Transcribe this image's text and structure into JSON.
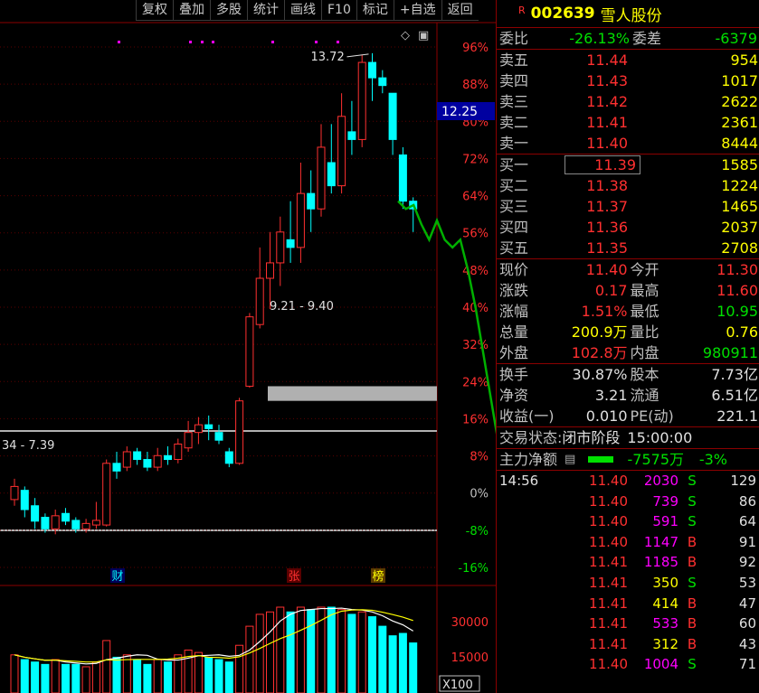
{
  "toolbar": {
    "items": [
      "复权",
      "叠加",
      "多股",
      "统计",
      "画线",
      "F10",
      "标记",
      "+自选",
      "返回"
    ]
  },
  "chart": {
    "pct_labels": [
      "96%",
      "88%",
      "80%",
      "72%",
      "64%",
      "56%",
      "48%",
      "40%",
      "32%",
      "24%",
      "16%",
      "8%",
      "0%",
      "-8%",
      "-16%"
    ],
    "price_tag": "12.25",
    "high_annotation": "13.72",
    "gap_label_1": "9.21 - 9.40",
    "gap_label_2": "34 - 7.39",
    "markers": {
      "cai": "财",
      "zhang": "张",
      "bang": "榜"
    },
    "vol_labels": [
      "30000",
      "15000"
    ],
    "vol_unit": "X100",
    "colors": {
      "up": "#ff3030",
      "down": "#00ffff",
      "ma1": "#ffffff",
      "ma2": "#ffff00",
      "forecast": "#00b000"
    }
  },
  "chart_data": {
    "type": "candlestick",
    "candles": [
      {
        "o": 7.93,
        "c": 8.1,
        "h": 8.2,
        "l": 7.85
      },
      {
        "o": 8.05,
        "c": 7.8,
        "h": 8.1,
        "l": 7.7
      },
      {
        "o": 7.85,
        "c": 7.65,
        "h": 7.95,
        "l": 7.55
      },
      {
        "o": 7.7,
        "c": 7.55,
        "h": 7.75,
        "l": 7.5
      },
      {
        "o": 7.55,
        "c": 7.72,
        "h": 7.8,
        "l": 7.48
      },
      {
        "o": 7.75,
        "c": 7.65,
        "h": 7.82,
        "l": 7.6
      },
      {
        "o": 7.66,
        "c": 7.55,
        "h": 7.7,
        "l": 7.5
      },
      {
        "o": 7.55,
        "c": 7.62,
        "h": 7.68,
        "l": 7.5
      },
      {
        "o": 7.6,
        "c": 7.66,
        "h": 7.9,
        "l": 7.55
      },
      {
        "o": 7.6,
        "c": 8.4,
        "h": 8.45,
        "l": 7.58
      },
      {
        "o": 8.4,
        "c": 8.3,
        "h": 8.55,
        "l": 8.2
      },
      {
        "o": 8.35,
        "c": 8.55,
        "h": 8.62,
        "l": 8.3
      },
      {
        "o": 8.55,
        "c": 8.45,
        "h": 8.6,
        "l": 8.38
      },
      {
        "o": 8.45,
        "c": 8.35,
        "h": 8.55,
        "l": 8.3
      },
      {
        "o": 8.35,
        "c": 8.5,
        "h": 8.6,
        "l": 8.3
      },
      {
        "o": 8.5,
        "c": 8.45,
        "h": 8.62,
        "l": 8.38
      },
      {
        "o": 8.45,
        "c": 8.65,
        "h": 8.72,
        "l": 8.4
      },
      {
        "o": 8.6,
        "c": 8.8,
        "h": 8.95,
        "l": 8.55
      },
      {
        "o": 8.8,
        "c": 8.9,
        "h": 9.0,
        "l": 8.65
      },
      {
        "o": 8.9,
        "c": 8.85,
        "h": 9.02,
        "l": 8.7
      },
      {
        "o": 8.8,
        "c": 8.7,
        "h": 8.9,
        "l": 8.65
      },
      {
        "o": 8.55,
        "c": 8.4,
        "h": 8.6,
        "l": 8.35
      },
      {
        "o": 8.4,
        "c": 9.21,
        "h": 9.25,
        "l": 8.38
      },
      {
        "o": 9.4,
        "c": 10.3,
        "h": 10.35,
        "l": 9.38
      },
      {
        "o": 10.2,
        "c": 10.8,
        "h": 11.2,
        "l": 10.15
      },
      {
        "o": 10.8,
        "c": 11.0,
        "h": 11.4,
        "l": 10.4
      },
      {
        "o": 11.0,
        "c": 11.4,
        "h": 11.6,
        "l": 10.7
      },
      {
        "o": 11.3,
        "c": 11.2,
        "h": 11.8,
        "l": 11.0
      },
      {
        "o": 11.2,
        "c": 11.9,
        "h": 12.3,
        "l": 11.0
      },
      {
        "o": 11.9,
        "c": 11.7,
        "h": 12.2,
        "l": 11.4
      },
      {
        "o": 11.7,
        "c": 12.5,
        "h": 12.8,
        "l": 11.6
      },
      {
        "o": 12.3,
        "c": 12.0,
        "h": 12.8,
        "l": 11.9
      },
      {
        "o": 12.0,
        "c": 12.9,
        "h": 13.2,
        "l": 11.9
      },
      {
        "o": 12.7,
        "c": 12.6,
        "h": 13.1,
        "l": 12.4
      },
      {
        "o": 12.6,
        "c": 13.6,
        "h": 13.7,
        "l": 12.5
      },
      {
        "o": 13.6,
        "c": 13.4,
        "h": 13.72,
        "l": 13.1
      },
      {
        "o": 13.4,
        "c": 13.3,
        "h": 13.5,
        "l": 13.2
      },
      {
        "o": 13.2,
        "c": 12.6,
        "h": 13.2,
        "l": 12.4
      },
      {
        "o": 12.4,
        "c": 11.8,
        "h": 12.5,
        "l": 11.7
      },
      {
        "o": 11.8,
        "c": 11.7,
        "h": 11.85,
        "l": 11.4
      }
    ],
    "volumes": [
      16,
      14,
      13,
      12,
      14,
      12,
      12,
      11,
      13,
      22,
      15,
      16,
      14,
      12,
      14,
      13,
      16,
      18,
      17,
      15,
      14,
      13,
      20,
      28,
      33,
      34,
      36,
      34,
      36,
      35,
      36,
      36,
      35,
      33,
      34,
      32,
      28,
      24,
      25,
      21
    ],
    "forecast": [
      11.8,
      11.7,
      11.75,
      11.5,
      11.3,
      11.55,
      11.3,
      11.2,
      11.3,
      10.9,
      10.4,
      9.8,
      9.2,
      8.6,
      8.0,
      7.6
    ],
    "price_ylim": [
      7.05,
      13.8
    ],
    "pct_ylim": [
      -16,
      96
    ]
  },
  "panel": {
    "flag": "R",
    "code": "002639",
    "name": "雪人股份",
    "weibi": {
      "l1": "委比",
      "v1": "-26.13%",
      "l2": "委差",
      "v2": "-6379"
    },
    "asks": [
      {
        "label": "卖五",
        "price": "11.44",
        "vol": "954"
      },
      {
        "label": "卖四",
        "price": "11.43",
        "vol": "1017"
      },
      {
        "label": "卖三",
        "price": "11.42",
        "vol": "2622"
      },
      {
        "label": "卖二",
        "price": "11.41",
        "vol": "2361"
      },
      {
        "label": "卖一",
        "price": "11.40",
        "vol": "8444"
      }
    ],
    "bids": [
      {
        "label": "买一",
        "price": "11.39",
        "vol": "1585"
      },
      {
        "label": "买二",
        "price": "11.38",
        "vol": "1224"
      },
      {
        "label": "买三",
        "price": "11.37",
        "vol": "1465"
      },
      {
        "label": "买四",
        "price": "11.36",
        "vol": "2037"
      },
      {
        "label": "买五",
        "price": "11.35",
        "vol": "2708"
      }
    ],
    "stats": [
      {
        "l1": "现价",
        "v1": "11.40",
        "l2": "今开",
        "v2": "11.30"
      },
      {
        "l1": "涨跌",
        "v1": "0.17",
        "l2": "最高",
        "v2": "11.60"
      },
      {
        "l1": "涨幅",
        "v1": "1.51%",
        "l2": "最低",
        "v2": "10.95"
      },
      {
        "l1": "总量",
        "v1": "200.9万",
        "l2": "量比",
        "v2": "0.76"
      },
      {
        "l1": "外盘",
        "v1": "102.8万",
        "l2": "内盘",
        "v2": "980911"
      }
    ],
    "stats2": [
      {
        "l1": "换手",
        "v1": "30.87%",
        "l2": "股本",
        "v2": "7.73亿"
      },
      {
        "l1": "净资",
        "v1": "3.21",
        "l2": "流通",
        "v2": "6.51亿"
      },
      {
        "l1": "收益(一)",
        "v1": "0.010",
        "l2": "PE(动)",
        "v2": "221.1"
      }
    ],
    "trade_status": {
      "label": "交易状态:",
      "value": "闭市阶段",
      "time": "15:00:00"
    },
    "main_flow": {
      "label": "主力净额",
      "value": "-7575万",
      "pct": "-3%"
    },
    "ticks": [
      {
        "time": "14:56",
        "price": "11.40",
        "vol": "2030",
        "side": "S",
        "n": "129"
      },
      {
        "time": "",
        "price": "11.40",
        "vol": "739",
        "side": "S",
        "n": "86"
      },
      {
        "time": "",
        "price": "11.40",
        "vol": "591",
        "side": "S",
        "n": "64"
      },
      {
        "time": "",
        "price": "11.40",
        "vol": "1147",
        "side": "B",
        "n": "91"
      },
      {
        "time": "",
        "price": "11.41",
        "vol": "1185",
        "side": "B",
        "n": "92"
      },
      {
        "time": "",
        "price": "11.41",
        "vol": "350",
        "side": "S",
        "n": "53"
      },
      {
        "time": "",
        "price": "11.41",
        "vol": "414",
        "side": "B",
        "n": "47"
      },
      {
        "time": "",
        "price": "11.41",
        "vol": "533",
        "side": "B",
        "n": "60"
      },
      {
        "time": "",
        "price": "11.41",
        "vol": "312",
        "side": "B",
        "n": "43"
      },
      {
        "time": "",
        "price": "11.40",
        "vol": "1004",
        "side": "S",
        "n": "71"
      }
    ]
  }
}
